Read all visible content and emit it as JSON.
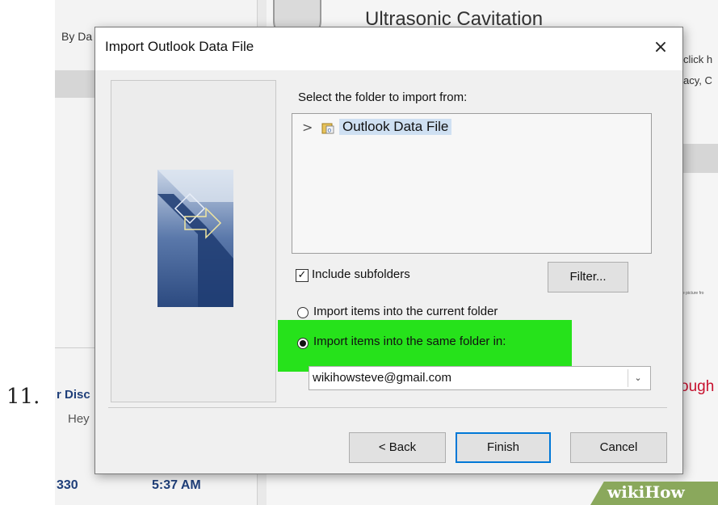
{
  "step_number": "11.",
  "background": {
    "left_header_text": "By Da",
    "email_subject_partial": "Ultrasonic Cavitation",
    "right_text_line1": "click h",
    "right_text_line2": "acy, C",
    "tiny_caption": "e picture fro",
    "message_sender_partial": "r Disc",
    "message_preview_partial": "Hey",
    "message_number": "330",
    "message_time": "5:37 AM",
    "right_red_text_partial": "ough"
  },
  "dialog": {
    "title": "Import Outlook Data File",
    "close_glyph": "×",
    "select_folder_label": "Select the folder to import from:",
    "tree": {
      "chevron": ">",
      "item_label": "Outlook Data File",
      "item_icon": "outlook-data-file-icon"
    },
    "include_subfolders": {
      "label": "Include subfolders",
      "checked": true,
      "check_glyph": "✓"
    },
    "filter_button": "Filter...",
    "radio_current_folder": {
      "label": "Import items into the current folder",
      "selected": false
    },
    "radio_same_folder": {
      "label": "Import items into the same folder in:",
      "selected": true
    },
    "account_select": {
      "value": "wikihowsteve@gmail.com",
      "arrow_glyph": "⌄"
    },
    "buttons": {
      "back": "< Back",
      "finish": "Finish",
      "cancel": "Cancel"
    }
  },
  "colors": {
    "highlight": "#26e21b",
    "finish_border": "#0078d7",
    "tree_selection": "#cfe0f2",
    "wikihow_green": "#8aa85c"
  },
  "watermark": {
    "prefix": "wiki",
    "suffix": "How"
  }
}
